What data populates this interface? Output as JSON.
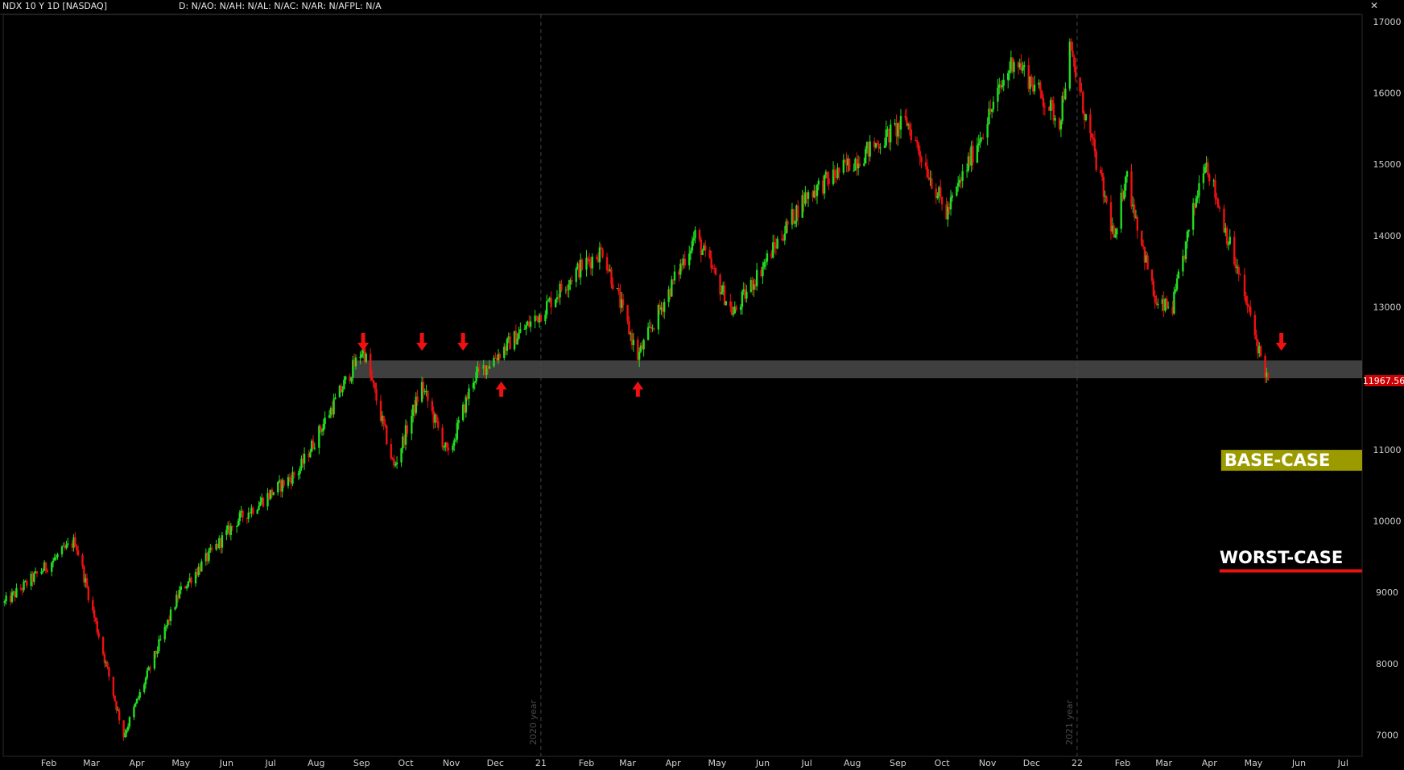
{
  "header": {
    "symbol": "NDX 10 Y 1D [NASDAQ]",
    "study": "D: N/AO: N/AH: N/AL: N/AC: N/AR: N/AFPL: N/A"
  },
  "colors": {
    "background": "#000000",
    "up": "#22dd22",
    "down": "#ee1111",
    "zone": "#4a4a4a",
    "base_case": "#9b9b00",
    "worst_case_line": "#ee1111",
    "price_tag": "#cc0000"
  },
  "chart_data": {
    "type": "candlestick",
    "title": "",
    "xlabel": "",
    "ylabel": "",
    "ylim": [
      6700,
      17100
    ],
    "x_ticks": [
      "Feb",
      "Mar",
      "Apr",
      "May",
      "Jun",
      "Jul",
      "Aug",
      "Sep",
      "Oct",
      "Nov",
      "Dec",
      "21",
      "Feb",
      "Mar",
      "Apr",
      "May",
      "Jun",
      "Jul",
      "Aug",
      "Sep",
      "Oct",
      "Nov",
      "Dec",
      "22",
      "Feb",
      "Mar",
      "Apr",
      "May",
      "Jun",
      "Jul"
    ],
    "x_tick_dates": [
      "2020-02",
      "2020-03",
      "2020-04",
      "2020-05",
      "2020-06",
      "2020-07",
      "2020-08",
      "2020-09",
      "2020-10",
      "2020-11",
      "2020-12",
      "2021-01",
      "2021-02",
      "2021-03",
      "2021-04",
      "2021-05",
      "2021-06",
      "2021-07",
      "2021-08",
      "2021-09",
      "2021-10",
      "2021-11",
      "2021-12",
      "2022-01",
      "2022-02",
      "2022-03",
      "2022-04",
      "2022-05",
      "2022-06",
      "2022-07"
    ],
    "y_ticks": [
      7000,
      8000,
      9000,
      10000,
      11000,
      12000,
      13000,
      14000,
      15000,
      16000,
      17000
    ],
    "last_price": "11967.56",
    "year_separators": [
      {
        "date": "2021-01",
        "label": "2020 year"
      },
      {
        "date": "2022-01",
        "label": "2021 year"
      }
    ],
    "series": [
      {
        "name": "NDX",
        "dates": [
          "2020-01-02",
          "2020-02-19",
          "2020-03-23",
          "2020-04-30",
          "2020-06-08",
          "2020-07-20",
          "2020-09-02",
          "2020-09-23",
          "2020-10-12",
          "2020-10-30",
          "2020-11-16",
          "2020-12-31",
          "2021-01-25",
          "2021-02-12",
          "2021-03-08",
          "2021-04-16",
          "2021-05-12",
          "2021-06-30",
          "2021-07-30",
          "2021-09-07",
          "2021-10-04",
          "2021-11-19",
          "2021-12-20",
          "2021-12-27",
          "2022-01-27",
          "2022-02-03",
          "2022-02-24",
          "2022-03-07",
          "2022-03-29",
          "2022-04-29",
          "2022-05-06",
          "2022-05-11"
        ],
        "close": [
          8850,
          9720,
          6994,
          9000,
          10000,
          10700,
          12420,
          10750,
          11900,
          10900,
          12000,
          12900,
          13500,
          13800,
          12300,
          14000,
          12900,
          14550,
          15000,
          15600,
          14300,
          16500,
          15600,
          16600,
          13900,
          14900,
          13000,
          13000,
          15100,
          12850,
          12300,
          11967.56
        ]
      }
    ],
    "zone": {
      "from": 12000,
      "to": 12250,
      "start_date": "2020-09-02"
    },
    "down_arrows": [
      "2020-09-02",
      "2020-10-12",
      "2020-11-09",
      "2022-05-20"
    ],
    "up_arrows": [
      "2020-12-05",
      "2021-03-08"
    ],
    "scenarios": {
      "base_case": {
        "label": "BASE-CASE",
        "level": 10850
      },
      "worst_case": {
        "label": "WORST-CASE",
        "level": 9300
      }
    }
  }
}
